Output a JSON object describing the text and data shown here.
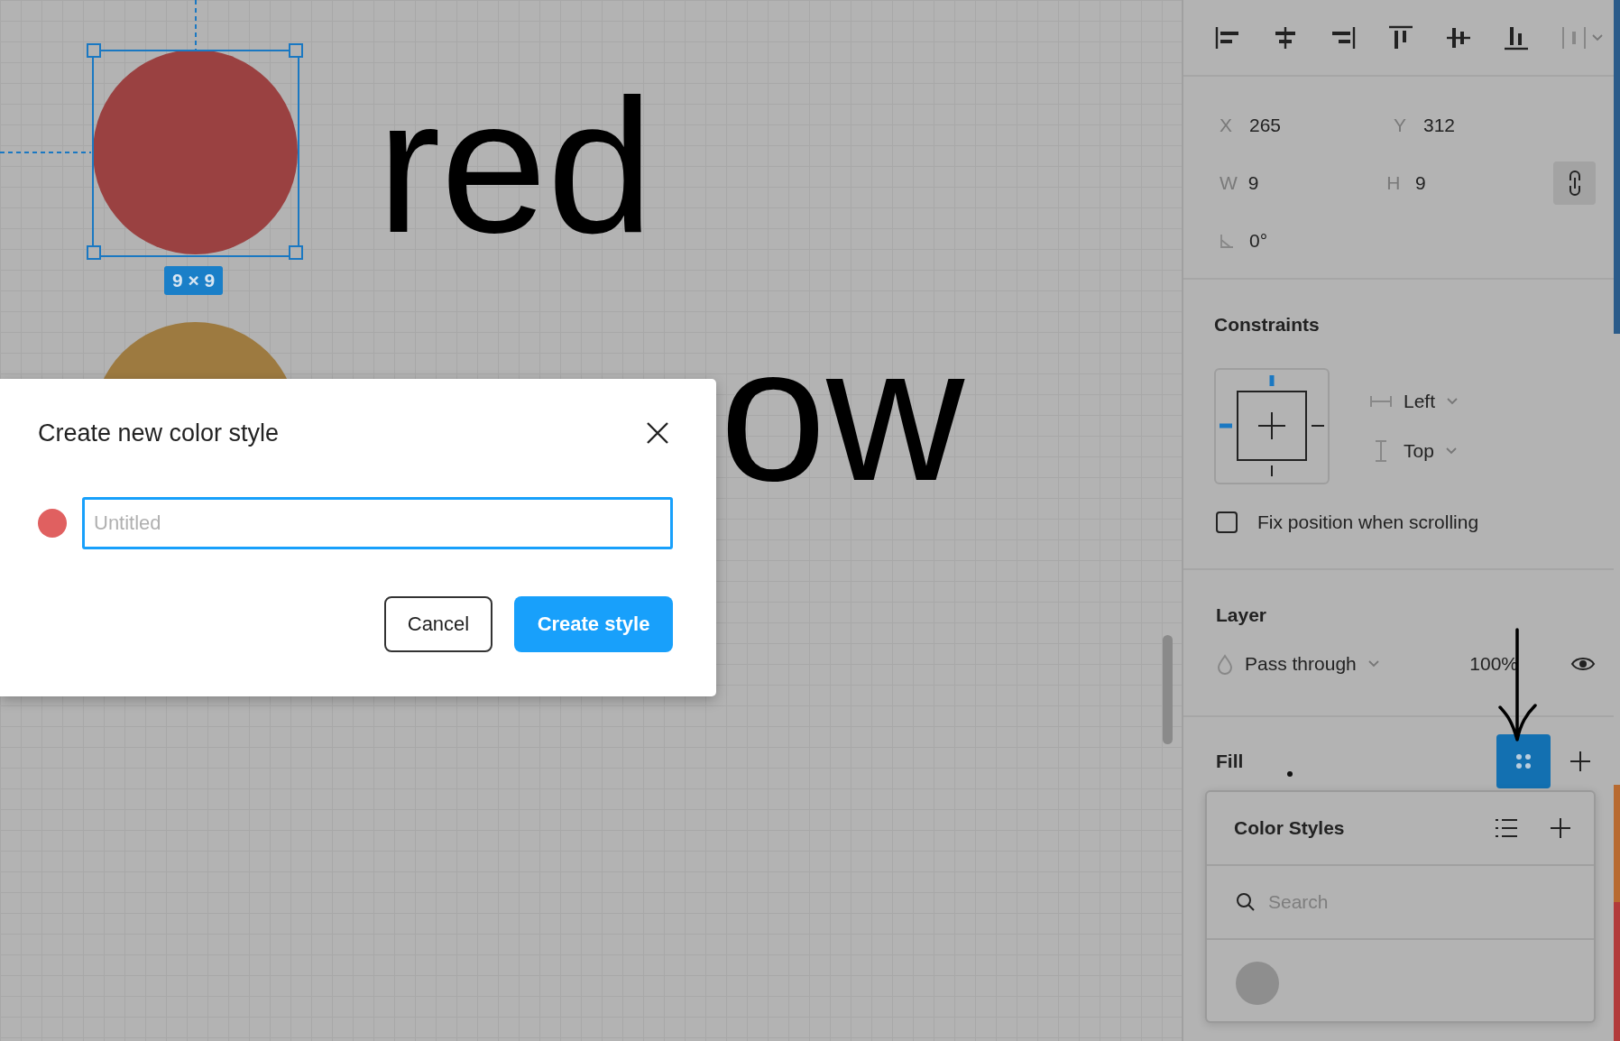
{
  "canvas": {
    "layers": [
      {
        "kind": "circle",
        "color": "#9a4141",
        "selected": true,
        "size_label": "9 × 9"
      },
      {
        "kind": "circle",
        "color": "#9d7a40",
        "selected": false
      }
    ],
    "texts": [
      "red",
      "ow"
    ]
  },
  "dialog": {
    "title": "Create new color style",
    "name_field": {
      "placeholder": "Untitled"
    },
    "buttons": [
      {
        "label": "Cancel",
        "kind": "secondary"
      },
      {
        "label": "Create style",
        "kind": "primary"
      }
    ]
  },
  "inspector": {
    "fields": [
      {
        "label": "X",
        "value": "265"
      },
      {
        "label": "Y",
        "value": "312"
      },
      {
        "label": "W",
        "value": "9"
      },
      {
        "label": "H",
        "value": "9"
      }
    ],
    "rotation": "0°",
    "constraints": {
      "title": "Constraints",
      "horizontal": "Left",
      "vertical": "Top",
      "fix_position": {
        "label": "Fix position when scrolling",
        "checked": false
      }
    },
    "layer": {
      "title": "Layer",
      "blend_mode": "Pass through",
      "opacity": "100%",
      "visible": true
    },
    "fill": {
      "title": "Fill",
      "styles_open": true
    },
    "color_styles": {
      "title": "Color Styles",
      "search": {
        "placeholder": "Search"
      }
    }
  }
}
